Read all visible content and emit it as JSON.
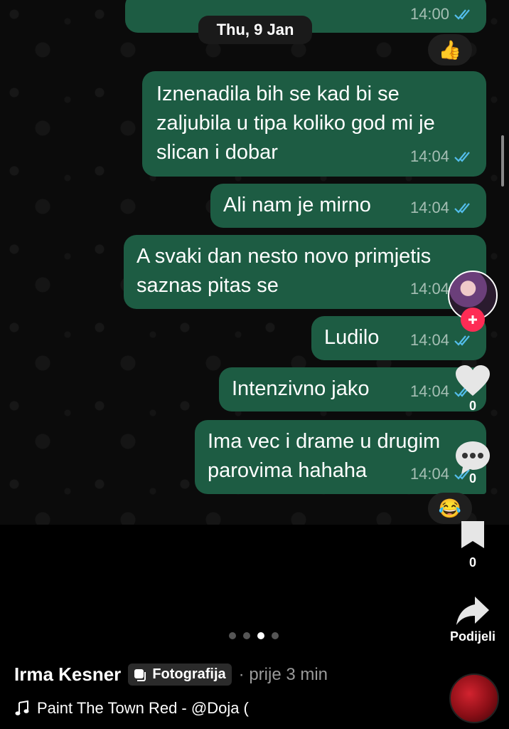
{
  "chat": {
    "date_pill": "Thu, 9 Jan",
    "top_bubble_time": "14:00",
    "reaction_top": "👍",
    "reaction_bottom": "😂",
    "messages": [
      {
        "text": "Iznenadila bih se kad bi se zaljubila u tipa koliko god mi je slican i dobar",
        "time": "14:04"
      },
      {
        "text": "Ali nam je mirno",
        "time": "14:04"
      },
      {
        "text": "A svaki dan nesto novo primjetis saznas pitas se",
        "time": "14:04"
      },
      {
        "text": "Ludilo",
        "time": "14:04"
      },
      {
        "text": "Intenzivno jako",
        "time": "14:04"
      },
      {
        "text": "Ima vec i drame u drugim parovima hahaha",
        "time": "14:04"
      }
    ]
  },
  "sidebar": {
    "likes": "0",
    "comments": "0",
    "saves": "0",
    "share_label": "Podijeli"
  },
  "carousel": {
    "total": 4,
    "active": 3
  },
  "post": {
    "author": "Irma Kesner",
    "tag": "Fotografija",
    "time": "· prije 3 min",
    "music": "Paint The Town Red - @Doja ("
  },
  "colors": {
    "bubble": "#1d5c43",
    "tick": "#53bdeb",
    "follow": "#fe2c55"
  },
  "icons": [
    "thumbs-up-icon",
    "tick-icon",
    "plus-icon",
    "heart-icon",
    "comment-icon",
    "bookmark-icon",
    "share-icon",
    "photo-tag-icon",
    "music-note-icon"
  ]
}
